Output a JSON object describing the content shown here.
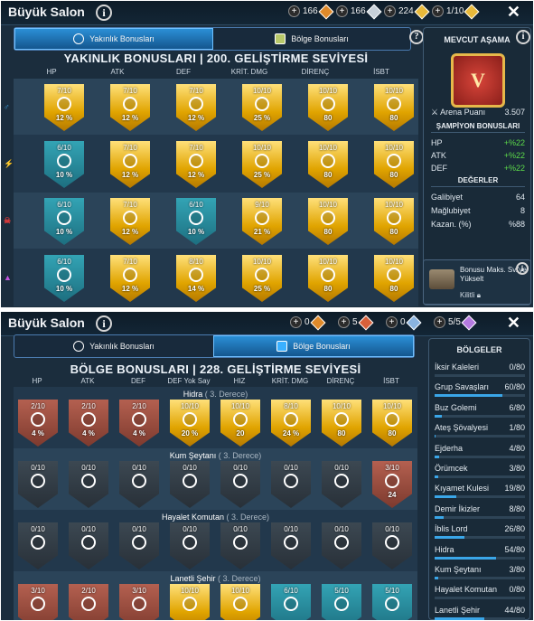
{
  "panel1": {
    "title": "Büyük Salon",
    "resources": [
      {
        "text": "166",
        "icon": "orange-shard-icon",
        "color": "#e08a2a"
      },
      {
        "text": "166",
        "icon": "silver-shard-icon",
        "color": "#c7d0d8"
      },
      {
        "text": "224",
        "icon": "gold-coin-icon",
        "color": "#e8b93a"
      },
      {
        "text": "1/10",
        "icon": "gold-coin-icon",
        "color": "#e8b93a"
      }
    ],
    "close": "✕",
    "tabs": [
      {
        "label": "Yakınlık Bonusları",
        "active": true
      },
      {
        "label": "Bölge Bonusları",
        "active": false
      }
    ],
    "section_title": "YAKINLIK BONUSLARI | 200. GELİŞTİRME SEVİYESİ",
    "columns": [
      "HP",
      "ATK",
      "DEF",
      "KRİT. DMG",
      "DİRENÇ",
      "İSBT"
    ],
    "rows": [
      {
        "icon": "♂",
        "color": "#3aa6e8",
        "cells": [
          {
            "lv": "7/10",
            "pc": "12 %",
            "t": "gold"
          },
          {
            "lv": "7/10",
            "pc": "12 %",
            "t": "gold"
          },
          {
            "lv": "7/10",
            "pc": "12 %",
            "t": "gold"
          },
          {
            "lv": "10/10",
            "pc": "25 %",
            "t": "gold"
          },
          {
            "lv": "10/10",
            "pc": "80",
            "t": "gold"
          },
          {
            "lv": "10/10",
            "pc": "80",
            "t": "gold"
          }
        ]
      },
      {
        "icon": "⚡",
        "color": "#4fd14a",
        "cells": [
          {
            "lv": "6/10",
            "pc": "10 %",
            "t": "teal"
          },
          {
            "lv": "7/10",
            "pc": "12 %",
            "t": "gold"
          },
          {
            "lv": "7/10",
            "pc": "12 %",
            "t": "gold"
          },
          {
            "lv": "10/10",
            "pc": "25 %",
            "t": "gold"
          },
          {
            "lv": "10/10",
            "pc": "80",
            "t": "gold"
          },
          {
            "lv": "10/10",
            "pc": "80",
            "t": "gold"
          }
        ]
      },
      {
        "icon": "☠",
        "color": "#e23a3a",
        "cells": [
          {
            "lv": "6/10",
            "pc": "10 %",
            "t": "teal"
          },
          {
            "lv": "7/10",
            "pc": "12 %",
            "t": "gold"
          },
          {
            "lv": "6/10",
            "pc": "10 %",
            "t": "teal"
          },
          {
            "lv": "9/10",
            "pc": "21 %",
            "t": "gold"
          },
          {
            "lv": "10/10",
            "pc": "80",
            "t": "gold"
          },
          {
            "lv": "10/10",
            "pc": "80",
            "t": "gold"
          }
        ]
      },
      {
        "icon": "▲",
        "color": "#c455e0",
        "cells": [
          {
            "lv": "6/10",
            "pc": "10 %",
            "t": "teal"
          },
          {
            "lv": "7/10",
            "pc": "12 %",
            "t": "gold"
          },
          {
            "lv": "8/10",
            "pc": "14 %",
            "t": "gold"
          },
          {
            "lv": "10/10",
            "pc": "25 %",
            "t": "gold"
          },
          {
            "lv": "10/10",
            "pc": "80",
            "t": "gold"
          },
          {
            "lv": "10/10",
            "pc": "80",
            "t": "gold"
          }
        ]
      }
    ],
    "side": {
      "title": "MEVCUT AŞAMA",
      "rank_letter": "V",
      "arena_label": "Arena Puanı",
      "arena_value": "3.507",
      "champ_title": "ŞAMPİYON BONUSLARI",
      "bonuses": [
        {
          "k": "HP",
          "v": "+%22"
        },
        {
          "k": "ATK",
          "v": "+%22"
        },
        {
          "k": "DEF",
          "v": "+%22"
        }
      ],
      "values_title": "DEĞERLER",
      "values": [
        {
          "k": "Galibiyet",
          "v": "64"
        },
        {
          "k": "Mağlubiyet",
          "v": "8"
        },
        {
          "k": "Kazan. (%)",
          "v": "%88"
        }
      ],
      "promo": "Bonusu Maks. Sv.'ye Yükselt",
      "lock": "Kilitli"
    }
  },
  "panel2": {
    "title": "Büyük Salon",
    "resources": [
      {
        "text": "0",
        "icon": "orange-shard-icon",
        "color": "#e08a2a"
      },
      {
        "text": "5",
        "icon": "red-shard-icon",
        "color": "#d8603a"
      },
      {
        "text": "0",
        "icon": "blue-shard-icon",
        "color": "#8ab4e0"
      },
      {
        "text": "5/5",
        "icon": "purple-gem-icon",
        "color": "#b57ae0"
      }
    ],
    "close": "✕",
    "tabs": [
      {
        "label": "Yakınlık Bonusları",
        "active": false
      },
      {
        "label": "Bölge Bonusları",
        "active": true
      }
    ],
    "section_title": "BÖLGE BONUSLARI | 228. GELİŞTİRME SEVİYESİ",
    "columns": [
      "HP",
      "ATK",
      "DEF",
      "DEF Yok Say",
      "HIZ",
      "KRİT. DMG",
      "DİRENÇ",
      "İSBT"
    ],
    "groups": [
      {
        "name": "Hidra",
        "deg": "( 3. Derece)",
        "cells": [
          {
            "lv": "2/10",
            "pc": "4 %",
            "t": "red"
          },
          {
            "lv": "2/10",
            "pc": "4 %",
            "t": "red"
          },
          {
            "lv": "2/10",
            "pc": "4 %",
            "t": "red"
          },
          {
            "lv": "10/10",
            "pc": "20 %",
            "t": "gold"
          },
          {
            "lv": "10/10",
            "pc": "20",
            "t": "gold"
          },
          {
            "lv": "8/10",
            "pc": "24 %",
            "t": "gold"
          },
          {
            "lv": "10/10",
            "pc": "80",
            "t": "gold"
          },
          {
            "lv": "10/10",
            "pc": "80",
            "t": "gold"
          }
        ]
      },
      {
        "name": "Kum Şeytanı",
        "deg": "( 3. Derece)",
        "cells": [
          {
            "lv": "0/10",
            "pc": "",
            "t": "gray"
          },
          {
            "lv": "0/10",
            "pc": "",
            "t": "gray"
          },
          {
            "lv": "0/10",
            "pc": "",
            "t": "gray"
          },
          {
            "lv": "0/10",
            "pc": "",
            "t": "gray"
          },
          {
            "lv": "0/10",
            "pc": "",
            "t": "gray"
          },
          {
            "lv": "0/10",
            "pc": "",
            "t": "gray"
          },
          {
            "lv": "0/10",
            "pc": "",
            "t": "gray"
          },
          {
            "lv": "3/10",
            "pc": "24",
            "t": "red"
          }
        ]
      },
      {
        "name": "Hayalet Komutan",
        "deg": "( 3. Derece)",
        "cells": [
          {
            "lv": "0/10",
            "pc": "",
            "t": "gray"
          },
          {
            "lv": "0/10",
            "pc": "",
            "t": "gray"
          },
          {
            "lv": "0/10",
            "pc": "",
            "t": "gray"
          },
          {
            "lv": "0/10",
            "pc": "",
            "t": "gray"
          },
          {
            "lv": "0/10",
            "pc": "",
            "t": "gray"
          },
          {
            "lv": "0/10",
            "pc": "",
            "t": "gray"
          },
          {
            "lv": "0/10",
            "pc": "",
            "t": "gray"
          },
          {
            "lv": "0/10",
            "pc": "",
            "t": "gray"
          }
        ]
      },
      {
        "name": "Lanetli Şehir",
        "deg": "( 3. Derece)",
        "cells": [
          {
            "lv": "3/10",
            "pc": "",
            "t": "red"
          },
          {
            "lv": "2/10",
            "pc": "",
            "t": "red"
          },
          {
            "lv": "3/10",
            "pc": "",
            "t": "red"
          },
          {
            "lv": "10/10",
            "pc": "",
            "t": "gold"
          },
          {
            "lv": "10/10",
            "pc": "",
            "t": "gold"
          },
          {
            "lv": "6/10",
            "pc": "",
            "t": "teal"
          },
          {
            "lv": "5/10",
            "pc": "",
            "t": "teal"
          },
          {
            "lv": "5/10",
            "pc": "",
            "t": "teal"
          }
        ]
      }
    ],
    "side": {
      "title": "BÖLGELER",
      "regions": [
        {
          "n": "İksir Kaleleri",
          "v": "0/80",
          "p": 0
        },
        {
          "n": "Grup Savaşları",
          "v": "60/80",
          "p": 0.75
        },
        {
          "n": "Buz Golemi",
          "v": "6/80",
          "p": 0.075
        },
        {
          "n": "Ateş Şövalyesi",
          "v": "1/80",
          "p": 0.0125
        },
        {
          "n": "Ejderha",
          "v": "4/80",
          "p": 0.05
        },
        {
          "n": "Örümcek",
          "v": "3/80",
          "p": 0.0375
        },
        {
          "n": "Kıyamet Kulesi",
          "v": "19/80",
          "p": 0.2375
        },
        {
          "n": "Demir İkizler",
          "v": "8/80",
          "p": 0.1
        },
        {
          "n": "İblis Lord",
          "v": "26/80",
          "p": 0.325
        },
        {
          "n": "Hidra",
          "v": "54/80",
          "p": 0.675
        },
        {
          "n": "Kum Şeytanı",
          "v": "3/80",
          "p": 0.0375
        },
        {
          "n": "Hayalet Komutan",
          "v": "0/80",
          "p": 0
        },
        {
          "n": "Lanetli Şehir",
          "v": "44/80",
          "p": 0.55
        }
      ]
    }
  }
}
